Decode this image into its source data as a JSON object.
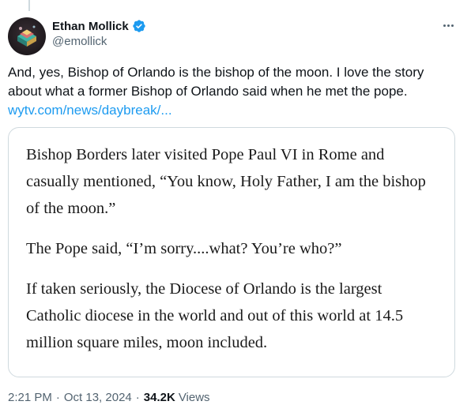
{
  "author": {
    "display_name": "Ethan Mollick",
    "handle": "@emollick",
    "verified": true
  },
  "tweet": {
    "text": "And, yes, Bishop of Orlando is the bishop of the moon. I love the story about what a former Bishop of Orlando said when he met the pope.",
    "link_text": "wytv.com/news/daybreak/..."
  },
  "quote_image": {
    "paragraphs": [
      "Bishop Borders later visited Pope Paul VI in Rome and casually mentioned, “You know, Holy Father, I am the bishop of the moon.”",
      "The Pope said, “I’m sorry....what? You’re who?”",
      "If taken seriously, the Diocese of Orlando is the largest Catholic diocese in the world and out of this world at 14.5 million square miles, moon included."
    ]
  },
  "meta": {
    "time": "2:21 PM",
    "separator": "·",
    "date": "Oct 13, 2024",
    "views_count": "34.2K",
    "views_label": "Views"
  },
  "colors": {
    "link": "#1d9bf0",
    "verified_badge": "#1d9bf0",
    "secondary_text": "#536471",
    "border": "#cfd9de"
  },
  "icons": {
    "verified": "verified-badge-icon",
    "more": "more-dots-icon"
  }
}
